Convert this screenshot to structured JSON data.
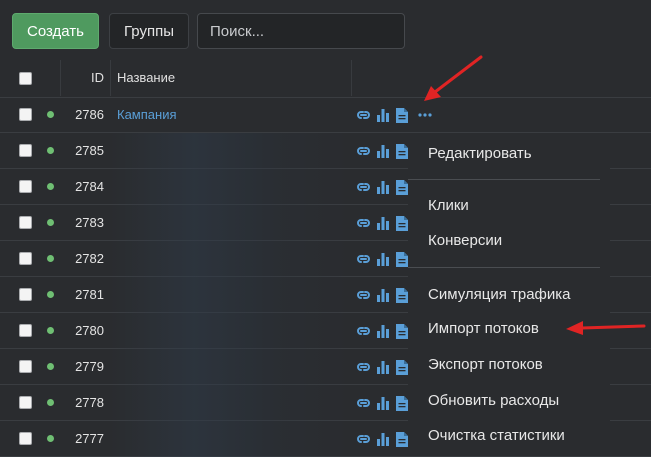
{
  "toolbar": {
    "create_label": "Создать",
    "groups_label": "Группы",
    "search_placeholder": "Поиск..."
  },
  "table": {
    "columns": {
      "id": "ID",
      "name": "Название"
    },
    "rows": [
      {
        "id": "2786",
        "name": "Кампания",
        "status": "active"
      },
      {
        "id": "2785",
        "name": "",
        "status": "active"
      },
      {
        "id": "2784",
        "name": "",
        "status": "active"
      },
      {
        "id": "2783",
        "name": "",
        "status": "active"
      },
      {
        "id": "2782",
        "name": "",
        "status": "active"
      },
      {
        "id": "2781",
        "name": "",
        "status": "active"
      },
      {
        "id": "2780",
        "name": "",
        "status": "active"
      },
      {
        "id": "2779",
        "name": "",
        "status": "active"
      },
      {
        "id": "2778",
        "name": "",
        "status": "active"
      },
      {
        "id": "2777",
        "name": "",
        "status": "active"
      }
    ],
    "row_actions": [
      "link-icon",
      "bar-chart-icon",
      "document-icon"
    ]
  },
  "context_menu": {
    "groups": [
      [
        "Редактировать"
      ],
      [
        "Клики",
        "Конверсии"
      ],
      [
        "Симуляция трафика",
        "Импорт потоков",
        "Экспорт потоков",
        "Обновить расходы",
        "Очистка статистики"
      ]
    ]
  },
  "colors": {
    "background": "#2a2c2f",
    "accent_green": "#4f9a5f",
    "link_blue": "#5a9fd8",
    "status_green": "#6fbf73",
    "annotation_red": "#e02424"
  }
}
